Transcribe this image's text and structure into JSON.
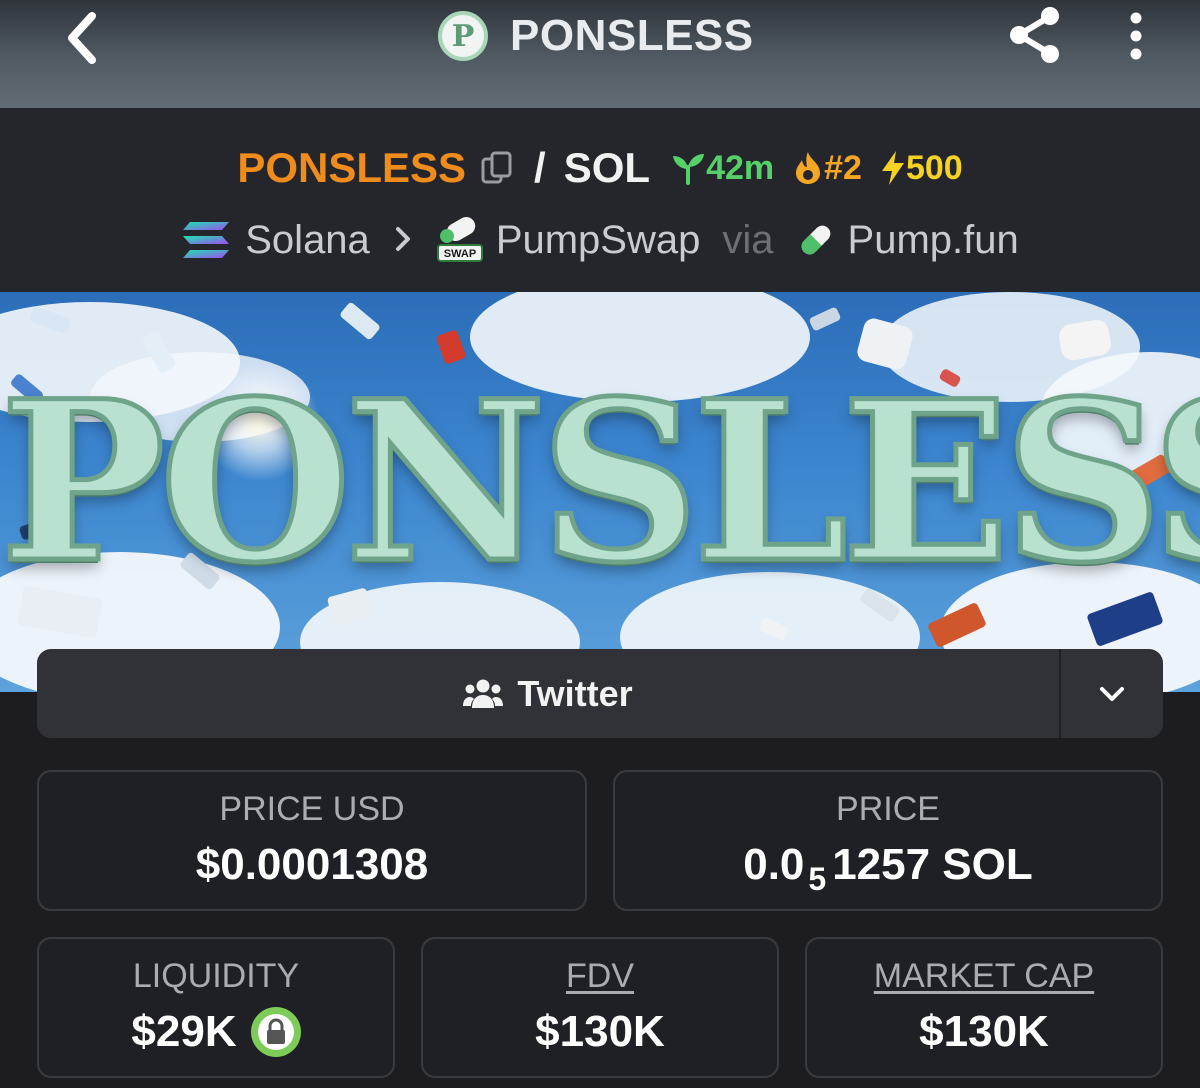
{
  "app": {
    "title": "PONSLESS",
    "logo_letter": "P"
  },
  "pair": {
    "token": "PONSLESS",
    "separator": "/",
    "quote": "SOL",
    "age": "42m",
    "rank": "#2",
    "boost": "500",
    "chain": "Solana",
    "dex": "PumpSwap",
    "dex_badge": "SWAP",
    "via": "via",
    "launchpad": "Pump.fun"
  },
  "banner": {
    "text": "PONSLESS"
  },
  "social": {
    "twitter_label": "Twitter"
  },
  "stats": {
    "price_usd_label": "PRICE USD",
    "price_usd_value": "$0.0001308",
    "price_label": "PRICE",
    "price_prefix": "0.0",
    "price_subscript": "5",
    "price_suffix": "1257 SOL",
    "liquidity_label": "LIQUIDITY",
    "liquidity_value": "$29K",
    "fdv_label": "FDV",
    "fdv_value": "$130K",
    "mcap_label": "MARKET CAP",
    "mcap_value": "$130K"
  },
  "colors": {
    "token_orange": "#f08c1c",
    "age_green": "#56d16a",
    "rank_orange": "#f5a623",
    "boost_yellow": "#f6d223",
    "lock_green": "#7ccc57"
  },
  "icons": {
    "back": "chevron-left-icon",
    "share": "share-icon",
    "more": "more-vertical-icon",
    "copy": "copy-icon",
    "age": "sprout-icon",
    "rank": "flame-icon",
    "boost": "lightning-icon",
    "chain": "solana-icon",
    "dex": "pumpswap-icon",
    "launch": "pill-icon",
    "users": "users-icon",
    "dropdown": "chevron-down-icon",
    "lock": "lock-icon"
  }
}
